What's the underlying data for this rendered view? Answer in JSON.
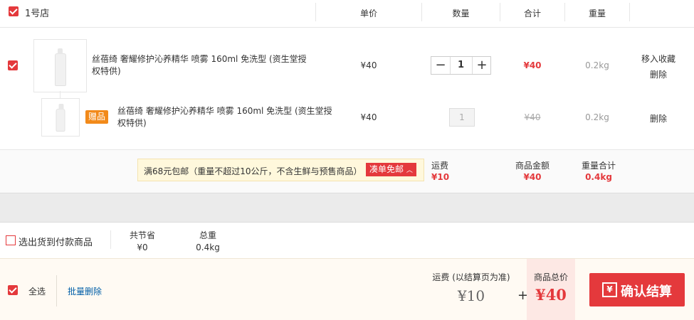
{
  "header": {
    "store_name": "1号店",
    "col_price": "单价",
    "col_qty": "数量",
    "col_total": "合计",
    "col_weight": "重量"
  },
  "item": {
    "title": "丝蓓绮 奢耀修护沁养精华 喷雾 160ml 免洗型 (资生堂授权特供)",
    "price": "¥40",
    "qty": "1",
    "total": "¥40",
    "weight": "0.2kg",
    "move_to_fav": "移入收藏",
    "delete": "删除"
  },
  "gift": {
    "badge": "赠品",
    "title": "丝蓓绮 奢耀修护沁养精华 喷雾 160ml 免洗型 (资生堂授权特供)",
    "price": "¥40",
    "qty": "1",
    "total": "¥40",
    "weight": "0.2kg",
    "delete": "删除"
  },
  "store_summary": {
    "promo_text": "满68元包邮（重量不超过10公斤，不含生鲜与预售商品）",
    "promo_button": "凑单免邮",
    "shipping_label": "运费",
    "shipping_value": "¥10",
    "goods_amount_label": "商品金额",
    "goods_amount_value": "¥40",
    "weight_total_label": "重量合计",
    "weight_total_value": "0.4kg"
  },
  "cod_bar": {
    "checkbox_label": "选出货到付款商品",
    "saved_label": "共节省",
    "saved_value": "¥0",
    "weight_label": "总重",
    "weight_value": "0.4kg"
  },
  "footer": {
    "select_all": "全选",
    "batch_delete": "批量删除",
    "shipping_label": "运费 (以结算页为准)",
    "shipping_value": "¥10",
    "plus": "+",
    "total_label": "商品总价",
    "total_value": "¥40",
    "checkout_icon": "¥",
    "checkout_label": "确认结算"
  },
  "colors": {
    "accent": "#e4393c",
    "promo_bg": "#fff8dc",
    "footer_bg": "#fffaf3"
  }
}
